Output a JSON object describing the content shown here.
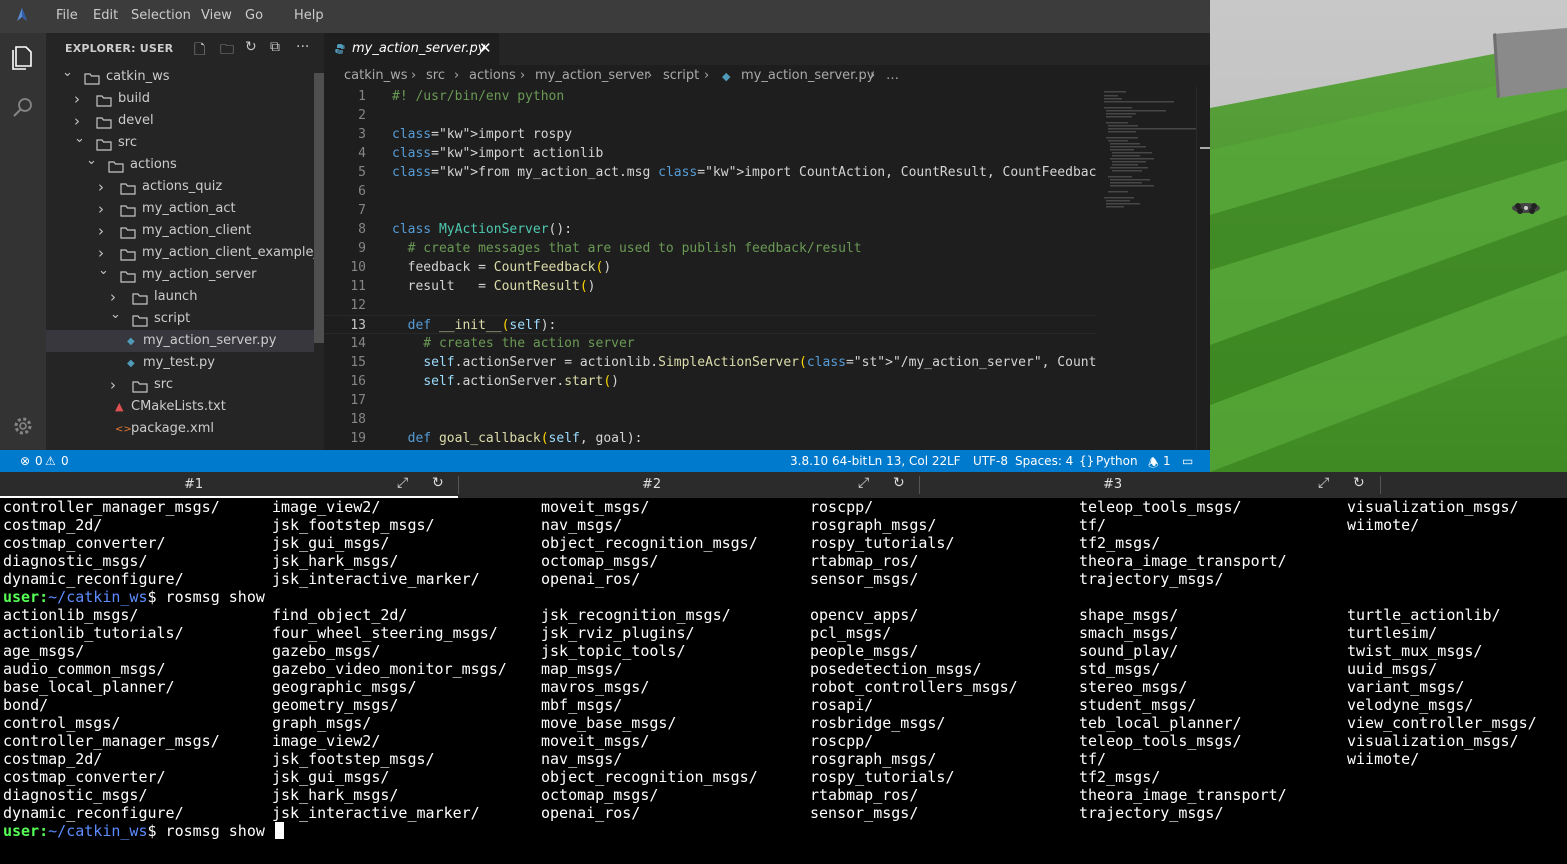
{
  "menu": [
    "File",
    "Edit",
    "Selection",
    "View",
    "Go",
    "Help"
  ],
  "sidebar": {
    "title": "EXPLORER: USER",
    "tree": [
      {
        "label": "catkin_ws",
        "type": "folder",
        "open": true,
        "depth": 0
      },
      {
        "label": "build",
        "type": "folder",
        "open": false,
        "depth": 1
      },
      {
        "label": "devel",
        "type": "folder",
        "open": false,
        "depth": 1
      },
      {
        "label": "src",
        "type": "folder",
        "open": true,
        "depth": 1
      },
      {
        "label": "actions",
        "type": "folder",
        "open": true,
        "depth": 2
      },
      {
        "label": "actions_quiz",
        "type": "folder",
        "open": false,
        "depth": 3
      },
      {
        "label": "my_action_act",
        "type": "folder",
        "open": false,
        "depth": 3
      },
      {
        "label": "my_action_client",
        "type": "folder",
        "open": false,
        "depth": 3
      },
      {
        "label": "my_action_client_example_pkg",
        "type": "folder",
        "open": false,
        "depth": 3
      },
      {
        "label": "my_action_server",
        "type": "folder",
        "open": true,
        "depth": 3
      },
      {
        "label": "launch",
        "type": "folder",
        "open": false,
        "depth": 4
      },
      {
        "label": "script",
        "type": "folder",
        "open": true,
        "depth": 4
      },
      {
        "label": "my_action_server.py",
        "type": "python",
        "depth": 5,
        "selected": true
      },
      {
        "label": "my_test.py",
        "type": "python",
        "depth": 5
      },
      {
        "label": "src",
        "type": "folder",
        "open": false,
        "depth": 4
      },
      {
        "label": "CMakeLists.txt",
        "type": "cmake",
        "depth": 4
      },
      {
        "label": "package.xml",
        "type": "xml",
        "depth": 4
      }
    ]
  },
  "editor": {
    "tab_label": "my_action_server.py",
    "breadcrumb": [
      "catkin_ws",
      "src",
      "actions",
      "my_action_server",
      "script",
      "my_action_server.py",
      "…"
    ],
    "current_line": 13,
    "lines": [
      {
        "n": "1",
        "text": "#! /usr/bin/env python"
      },
      {
        "n": "2",
        "text": ""
      },
      {
        "n": "3",
        "text": "import rospy"
      },
      {
        "n": "4",
        "text": "import actionlib"
      },
      {
        "n": "5",
        "text": "from my_action_act.msg import CountAction, CountResult, CountFeedback"
      },
      {
        "n": "6",
        "text": ""
      },
      {
        "n": "7",
        "text": ""
      },
      {
        "n": "8",
        "text": "class MyActionServer():"
      },
      {
        "n": "9",
        "text": "  # create messages that are used to publish feedback/result"
      },
      {
        "n": "10",
        "text": "  feedback = CountFeedback()"
      },
      {
        "n": "11",
        "text": "  result   = CountResult()"
      },
      {
        "n": "12",
        "text": ""
      },
      {
        "n": "13",
        "text": "  def __init__(self):"
      },
      {
        "n": "14",
        "text": "    # creates the action server"
      },
      {
        "n": "15",
        "text": "    self.actionServer = actionlib.SimpleActionServer(\"/my_action_server\", CountAction, self."
      },
      {
        "n": "16",
        "text": "    self.actionServer.start()"
      },
      {
        "n": "17",
        "text": ""
      },
      {
        "n": "18",
        "text": ""
      },
      {
        "n": "19",
        "text": "  def goal_callback(self, goal):"
      }
    ]
  },
  "statusbar": {
    "errors": "0",
    "warnings": "0",
    "interpreter": "3.8.10 64-bit",
    "position": "Ln 13, Col 22",
    "eol": "LF",
    "encoding": "UTF-8",
    "indent": "Spaces: 4",
    "language": "Python",
    "notifications": "1"
  },
  "terminal_tabs": [
    "#1",
    "#2",
    "#3"
  ],
  "terminal": {
    "lines": [
      {
        "cols": [
          "controller_manager_msgs/",
          "image_view2/",
          "moveit_msgs/",
          "roscpp/",
          "teleop_tools_msgs/",
          "visualization_msgs/"
        ]
      },
      {
        "cols": [
          "costmap_2d/",
          "jsk_footstep_msgs/",
          "nav_msgs/",
          "rosgraph_msgs/",
          "tf/",
          "wiimote/"
        ]
      },
      {
        "cols": [
          "costmap_converter/",
          "jsk_gui_msgs/",
          "object_recognition_msgs/",
          "rospy_tutorials/",
          "tf2_msgs/",
          ""
        ]
      },
      {
        "cols": [
          "diagnostic_msgs/",
          "jsk_hark_msgs/",
          "octomap_msgs/",
          "rtabmap_ros/",
          "theora_image_transport/",
          ""
        ]
      },
      {
        "cols": [
          "dynamic_reconfigure/",
          "jsk_interactive_marker/",
          "openai_ros/",
          "sensor_msgs/",
          "trajectory_msgs/",
          ""
        ]
      },
      {
        "prompt": true,
        "user": "user",
        "path": "~/catkin_ws",
        "cmd": " rosmsg show"
      },
      {
        "cols": [
          "actionlib_msgs/",
          "find_object_2d/",
          "jsk_recognition_msgs/",
          "opencv_apps/",
          "shape_msgs/",
          "turtle_actionlib/"
        ]
      },
      {
        "cols": [
          "actionlib_tutorials/",
          "four_wheel_steering_msgs/",
          "jsk_rviz_plugins/",
          "pcl_msgs/",
          "smach_msgs/",
          "turtlesim/"
        ]
      },
      {
        "cols": [
          "age_msgs/",
          "gazebo_msgs/",
          "jsk_topic_tools/",
          "people_msgs/",
          "sound_play/",
          "twist_mux_msgs/"
        ]
      },
      {
        "cols": [
          "audio_common_msgs/",
          "gazebo_video_monitor_msgs/",
          "map_msgs/",
          "posedetection_msgs/",
          "std_msgs/",
          "uuid_msgs/"
        ]
      },
      {
        "cols": [
          "base_local_planner/",
          "geographic_msgs/",
          "mavros_msgs/",
          "robot_controllers_msgs/",
          "stereo_msgs/",
          "variant_msgs/"
        ]
      },
      {
        "cols": [
          "bond/",
          "geometry_msgs/",
          "mbf_msgs/",
          "rosapi/",
          "student_msgs/",
          "velodyne_msgs/"
        ]
      },
      {
        "cols": [
          "control_msgs/",
          "graph_msgs/",
          "move_base_msgs/",
          "rosbridge_msgs/",
          "teb_local_planner/",
          "view_controller_msgs/"
        ]
      },
      {
        "cols": [
          "controller_manager_msgs/",
          "image_view2/",
          "moveit_msgs/",
          "roscpp/",
          "teleop_tools_msgs/",
          "visualization_msgs/"
        ]
      },
      {
        "cols": [
          "costmap_2d/",
          "jsk_footstep_msgs/",
          "nav_msgs/",
          "rosgraph_msgs/",
          "tf/",
          "wiimote/"
        ]
      },
      {
        "cols": [
          "costmap_converter/",
          "jsk_gui_msgs/",
          "object_recognition_msgs/",
          "rospy_tutorials/",
          "tf2_msgs/",
          ""
        ]
      },
      {
        "cols": [
          "diagnostic_msgs/",
          "jsk_hark_msgs/",
          "octomap_msgs/",
          "rtabmap_ros/",
          "theora_image_transport/",
          ""
        ]
      },
      {
        "cols": [
          "dynamic_reconfigure/",
          "jsk_interactive_marker/",
          "openai_ros/",
          "sensor_msgs/",
          "trajectory_msgs/",
          ""
        ]
      },
      {
        "prompt": true,
        "user": "user",
        "path": "~/catkin_ws",
        "cmd": " rosmsg show ",
        "cursor": true
      }
    ]
  }
}
